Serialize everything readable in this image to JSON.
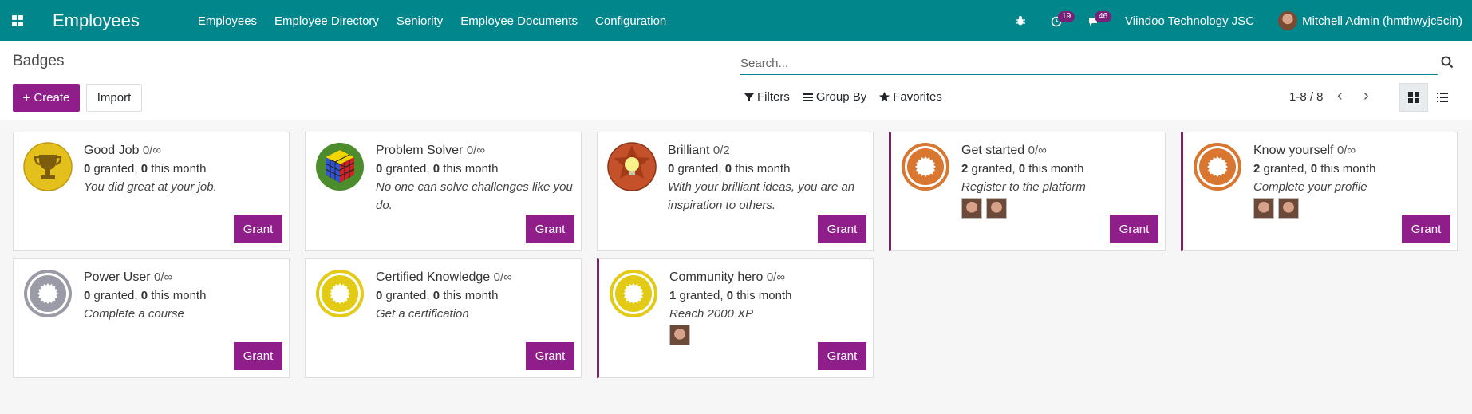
{
  "navbar": {
    "app_title": "Employees",
    "menu": [
      "Employees",
      "Employee Directory",
      "Seniority",
      "Employee Documents",
      "Configuration"
    ],
    "activity_count": "19",
    "message_count": "46",
    "company": "Viindoo Technology JSC",
    "user": "Mitchell Admin (hmthwyjc5cin)"
  },
  "control": {
    "breadcrumb": "Badges",
    "search_placeholder": "Search...",
    "create_label": "Create",
    "import_label": "Import",
    "filters_label": "Filters",
    "groupby_label": "Group By",
    "favorites_label": "Favorites",
    "pager": "1-8 / 8"
  },
  "colors": {
    "navbar": "#00868b",
    "primary": "#8f1e8b",
    "highlight_border": "#7a1f5f"
  },
  "badges": [
    {
      "name": "Good Job",
      "stat": "0/∞",
      "granted": "0",
      "month": "0",
      "desc": "You did great at your job.",
      "icon": "trophy-icon",
      "owners": 0,
      "highlight": false,
      "grant": "Grant"
    },
    {
      "name": "Problem Solver",
      "stat": "0/∞",
      "granted": "0",
      "month": "0",
      "desc": "No one can solve challenges like you do.",
      "icon": "rubiks-cube-icon",
      "owners": 0,
      "highlight": false,
      "grant": "Grant"
    },
    {
      "name": "Brilliant",
      "stat": "0/2",
      "granted": "0",
      "month": "0",
      "desc": "With your brilliant ideas, you are an inspiration to others.",
      "icon": "lightbulb-star-icon",
      "owners": 0,
      "highlight": false,
      "grant": "Grant"
    },
    {
      "name": "Get started",
      "stat": "0/∞",
      "granted": "2",
      "month": "0",
      "desc": "Register to the platform",
      "icon": "bronze-medal-icon",
      "owners": 2,
      "highlight": true,
      "grant": "Grant"
    },
    {
      "name": "Know yourself",
      "stat": "0/∞",
      "granted": "2",
      "month": "0",
      "desc": "Complete your profile",
      "icon": "bronze-medal-icon",
      "owners": 2,
      "highlight": true,
      "grant": "Grant"
    },
    {
      "name": "Power User",
      "stat": "0/∞",
      "granted": "0",
      "month": "0",
      "desc": "Complete a course",
      "icon": "silver-medal-icon",
      "owners": 0,
      "highlight": false,
      "grant": "Grant"
    },
    {
      "name": "Certified Knowledge",
      "stat": "0/∞",
      "granted": "0",
      "month": "0",
      "desc": "Get a certification",
      "icon": "gold-medal-icon",
      "owners": 0,
      "highlight": false,
      "grant": "Grant"
    },
    {
      "name": "Community hero",
      "stat": "0/∞",
      "granted": "1",
      "month": "0",
      "desc": "Reach 2000 XP",
      "icon": "gold-medal-icon",
      "owners": 1,
      "highlight": true,
      "grant": "Grant"
    }
  ],
  "labels": {
    "granted_suffix": " granted, ",
    "month_suffix": " this month"
  }
}
